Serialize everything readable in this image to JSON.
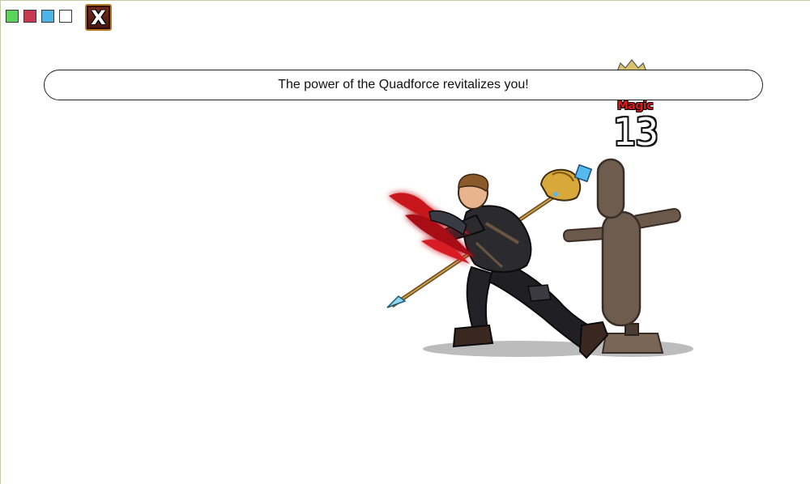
{
  "toolbar": {
    "swatches": [
      {
        "name": "green",
        "color": "#5dd35a"
      },
      {
        "name": "red",
        "color": "#c8384f"
      },
      {
        "name": "blue",
        "color": "#4cb4e6"
      },
      {
        "name": "white",
        "color": "#ffffff"
      }
    ],
    "close_label": "X"
  },
  "message": "The power of the Quadforce revitalizes you!",
  "damage": {
    "type_label": "Magic",
    "value": "13"
  },
  "colors": {
    "accent_red": "#e01a1a",
    "close_border": "#b5781e",
    "dummy_wood": "#6b5a4c",
    "shadow": "#bcbcbc"
  },
  "icons": [
    "crown-icon",
    "close-icon"
  ]
}
